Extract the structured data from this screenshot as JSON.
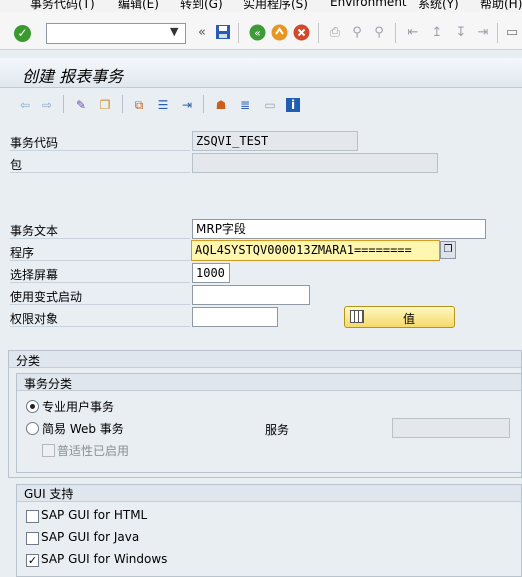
{
  "menu": {
    "items": [
      "事务代码(T)",
      "编辑(E)",
      "转到(G)",
      "实用程序(S)",
      "Environment",
      "系统(Y)",
      "帮助(H)"
    ]
  },
  "toolbar": {
    "command_field_value": "",
    "icons": [
      "ok-check",
      "back",
      "exit",
      "cancel",
      "save",
      "print",
      "find",
      "find-next",
      "first-page",
      "prev-page",
      "next-page",
      "last-page",
      "new-session"
    ]
  },
  "title": "创建 报表事务",
  "app_toolbar": {
    "icons": [
      "back-arrow",
      "forward-arrow",
      "display-change",
      "other-object",
      "where-used",
      "object-list",
      "navigate",
      "hierarchy",
      "align",
      "layout",
      "info"
    ]
  },
  "form": {
    "tcode_label": "事务代码",
    "tcode_value": "ZSQVI_TEST",
    "package_label": "包",
    "package_value": "",
    "text_label": "事务文本",
    "text_value": "MRP字段",
    "program_label": "程序",
    "program_value": "AQL4SYSTQV000013ZMARA1========",
    "screen_label": "选择屏幕",
    "screen_value": "1000",
    "variant_label": "使用变式启动",
    "variant_value": "",
    "auth_label": "权限对象",
    "auth_value": "",
    "value_button": "值"
  },
  "classification": {
    "title": "分类",
    "sub_title": "事务分类",
    "radio_pro": "专业用户事务",
    "radio_web": "简易 Web 事务",
    "service_label": "服务",
    "service_value": "",
    "inherit_gui": "普适性已启用"
  },
  "gui": {
    "title": "GUI 支持",
    "html": "SAP GUI for HTML",
    "java": "SAP GUI for Java",
    "windows": "SAP GUI for Windows",
    "html_checked": false,
    "java_checked": false,
    "windows_checked": true
  }
}
